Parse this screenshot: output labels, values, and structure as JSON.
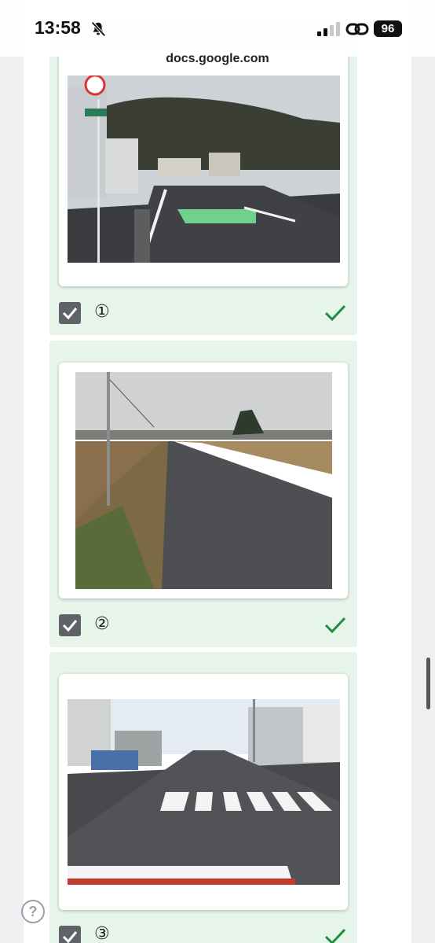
{
  "status": {
    "time": "13:58",
    "battery": "96"
  },
  "browser": {
    "url": "docs.google.com"
  },
  "options": [
    {
      "label": "①",
      "checked": true,
      "correct": true
    },
    {
      "label": "②",
      "checked": true,
      "correct": true
    },
    {
      "label": "③",
      "checked": true,
      "correct": true
    }
  ],
  "help": {
    "label": "?"
  },
  "colors": {
    "card_bg": "#e6f4ea",
    "check_green": "#1e8e3e",
    "checkbox_gray": "#5f6368"
  }
}
